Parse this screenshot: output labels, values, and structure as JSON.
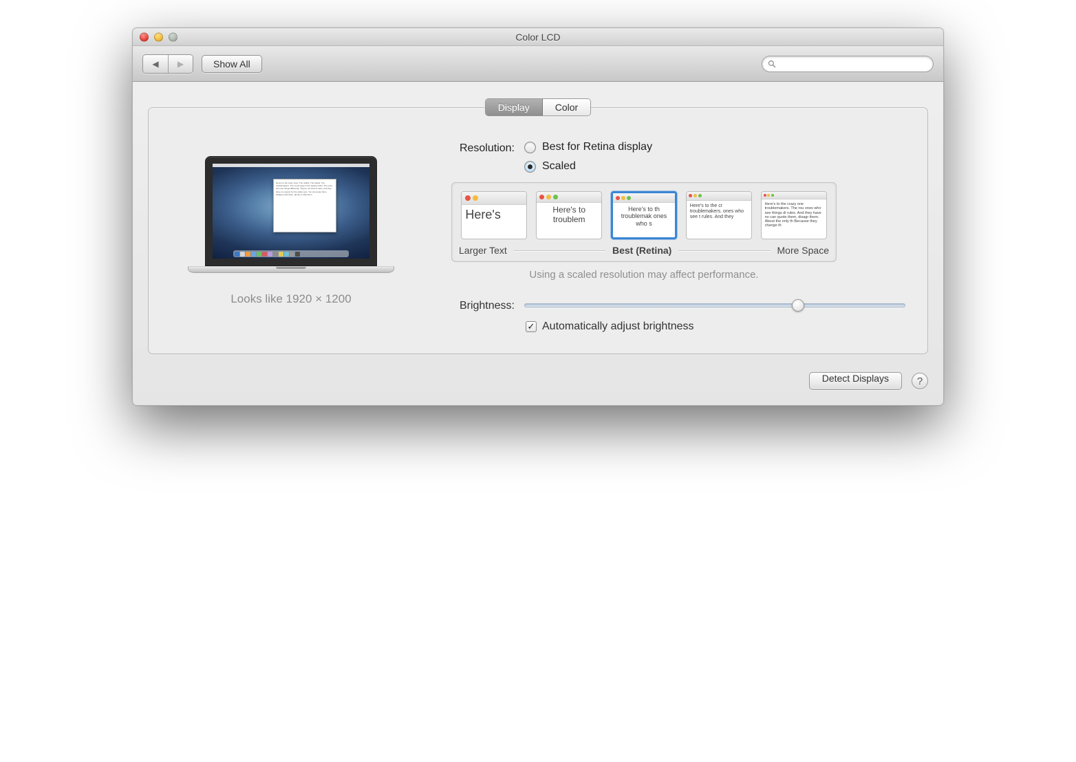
{
  "window": {
    "title": "Color LCD"
  },
  "toolbar": {
    "show_all": "Show All",
    "search_placeholder": ""
  },
  "tabs": {
    "display": "Display",
    "color": "Color",
    "active": "display"
  },
  "preview": {
    "caption": "Looks like 1920 × 1200"
  },
  "resolution": {
    "label": "Resolution:",
    "best_label": "Best for Retina display",
    "scaled_label": "Scaled",
    "selected": "scaled",
    "scale_left": "Larger Text",
    "scale_center": "Best (Retina)",
    "scale_right": "More Space",
    "perf_note": "Using a scaled resolution may affect performance.",
    "thumbs": [
      {
        "sample": "Here's"
      },
      {
        "sample": "Here's to troublem"
      },
      {
        "sample": "Here's to th troublemak ones who s"
      },
      {
        "sample": "Here's to the cr troublemakers. ones who see t rules. And they"
      },
      {
        "sample": "Here's to the crazy one troublemakers. The rou ones who see things di rules. And they have no can quote them, disagr them. About the only th Because they change th"
      }
    ],
    "selected_index": 2
  },
  "brightness": {
    "label": "Brightness:",
    "value_percent": 72,
    "auto_label": "Automatically adjust brightness",
    "auto_checked": true
  },
  "footer": {
    "detect": "Detect Displays"
  }
}
